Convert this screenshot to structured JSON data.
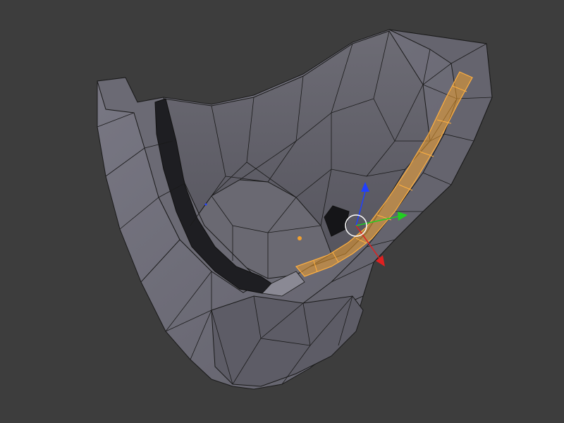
{
  "viewport": {
    "background": "#3d3d3d"
  },
  "mesh": {
    "base_color": "#74737c",
    "edge_color": "#1a1a1a",
    "selection_color": "#f0a030",
    "selection_edge_color": "#ffb040",
    "dark_groove_color": "#1e1e22"
  },
  "gizmo": {
    "x_axis_color": "#e02020",
    "y_axis_color": "#20d020",
    "z_axis_color": "#2040ff",
    "cursor_color": "#ffffff"
  },
  "icons": {
    "transform_gizmo": "transform-gizmo-icon",
    "object_origin": "object-origin-icon"
  }
}
